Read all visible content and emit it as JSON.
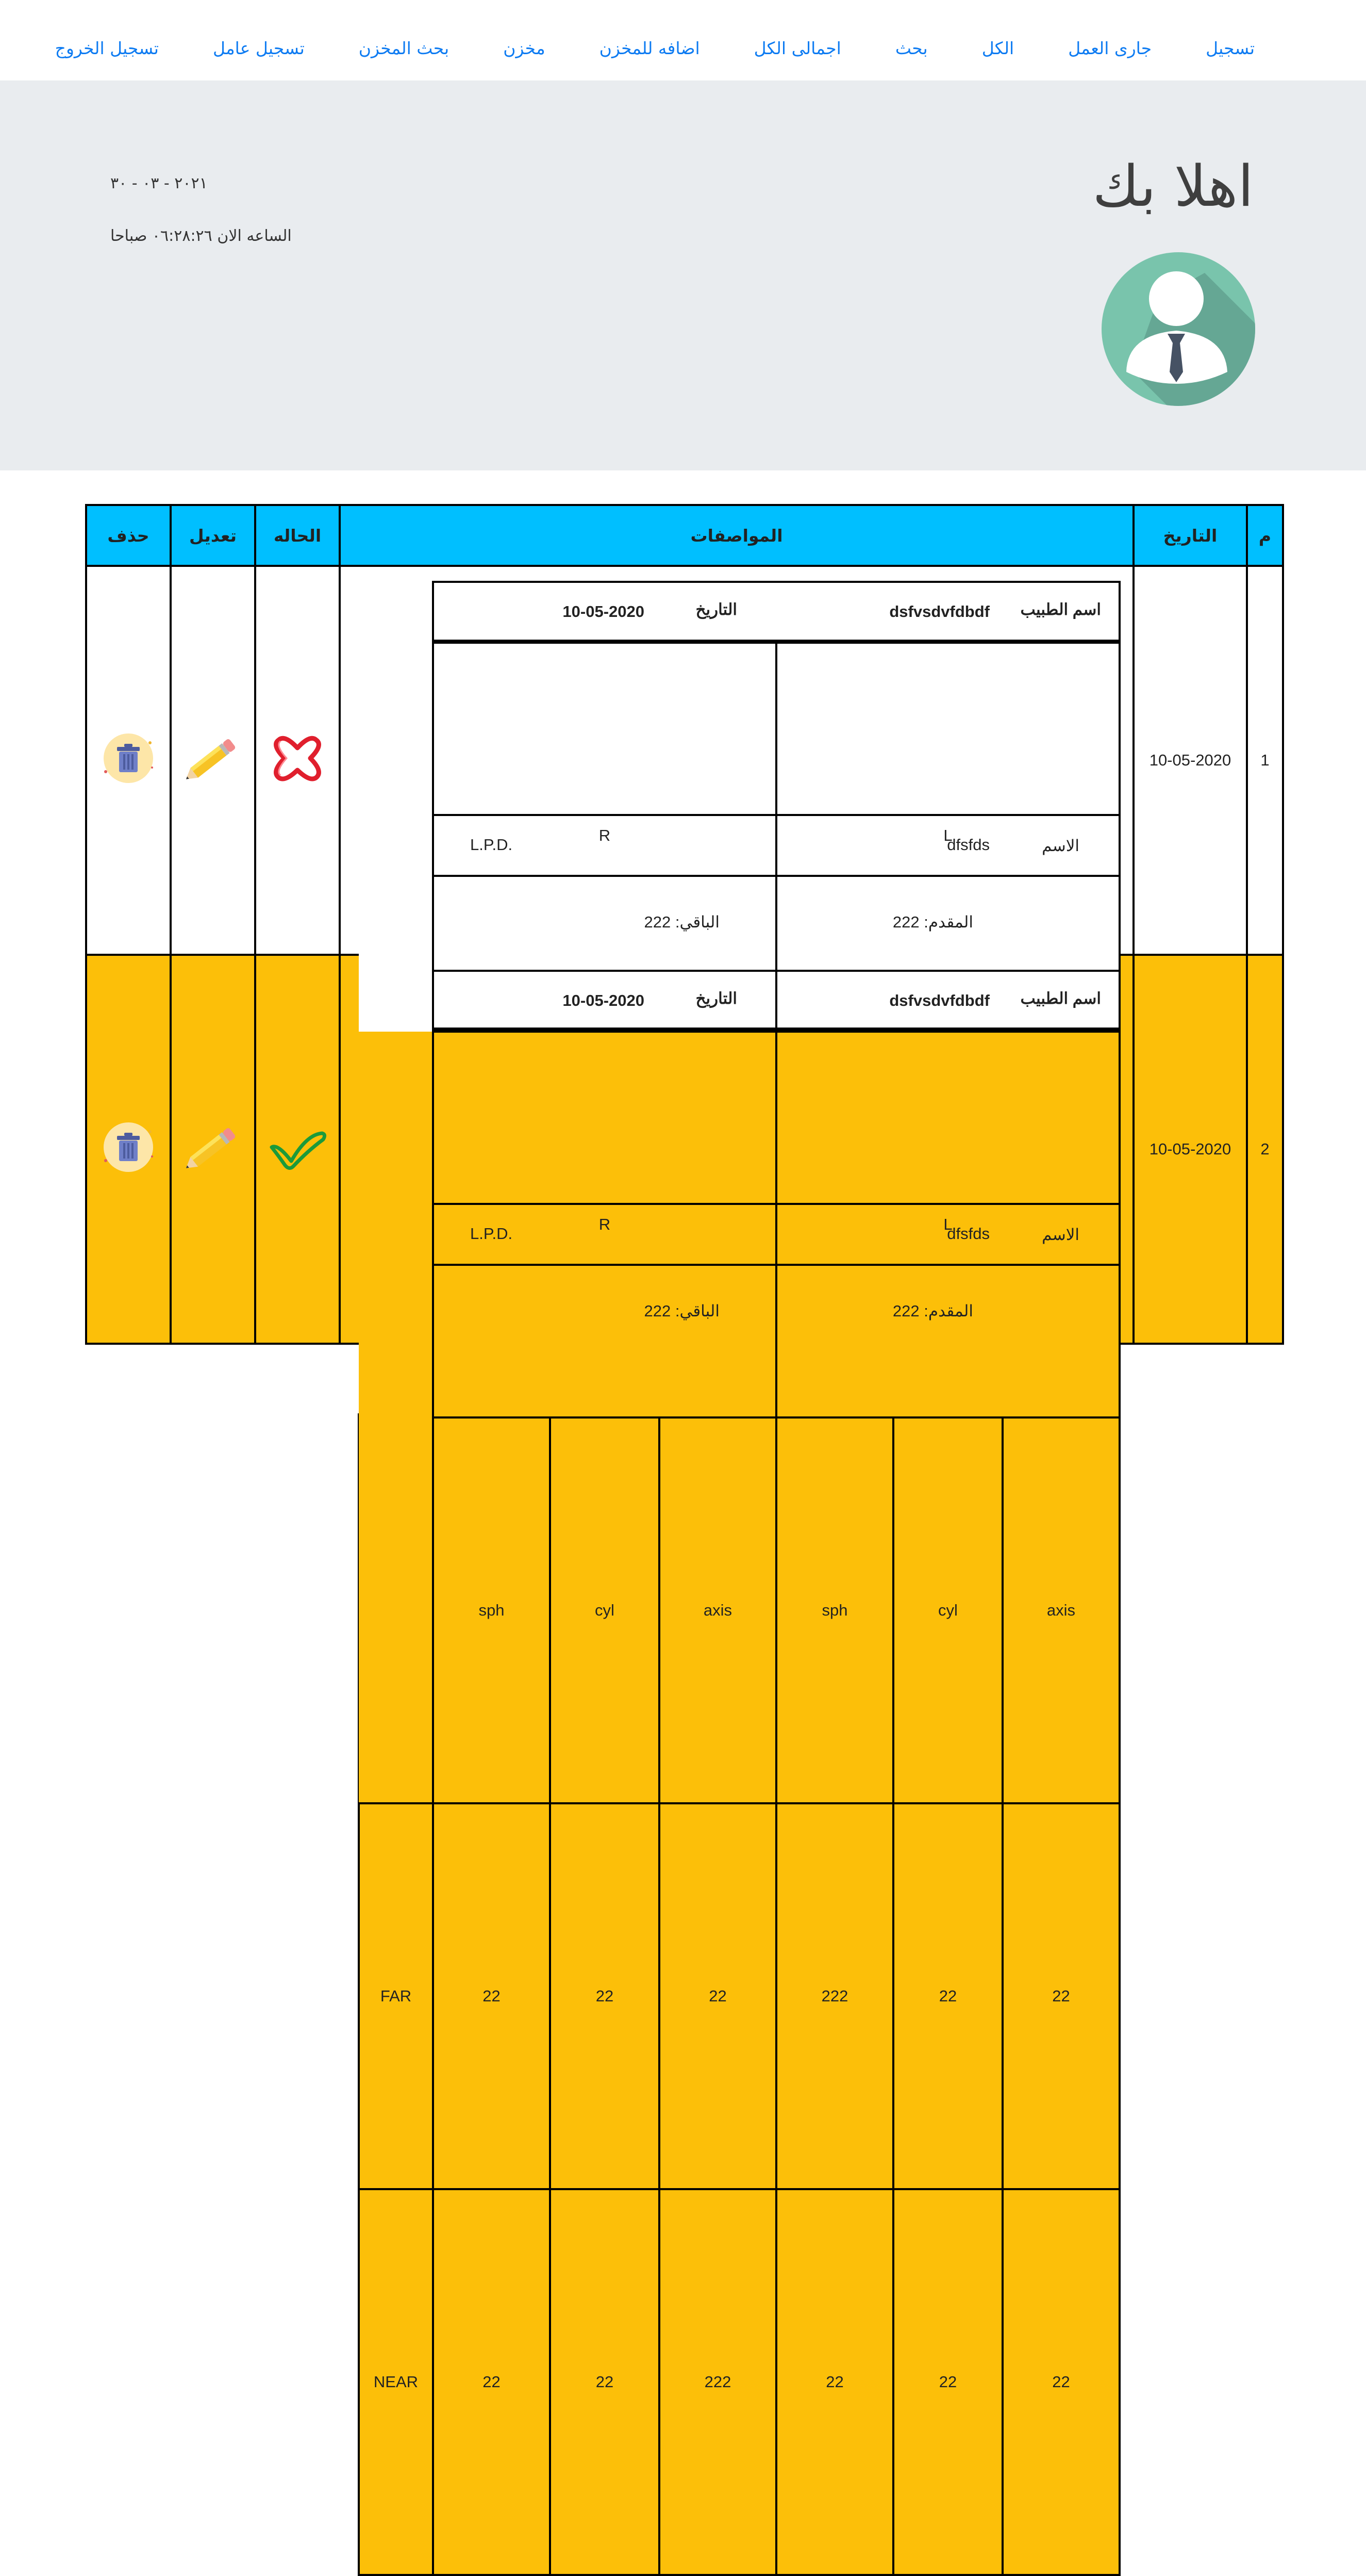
{
  "nav": {
    "items": [
      "تسجيل",
      "جارى العمل",
      "الكل",
      "بحث",
      "اجمالى الكل",
      "اضافه للمخزن",
      "مخزن",
      "بحث المخزن",
      "تسجيل عامل",
      "تسجيل الخروج"
    ]
  },
  "hero": {
    "title": "اهلا بك",
    "date": "٢٠٢١ - ٠٣ - ٣٠",
    "time": "الساعه الان ٠٦:٢٨:٢٦ صباحا",
    "avatar_icon": "user-avatar-icon",
    "avatar_color": "#79c4ac"
  },
  "table": {
    "headers": {
      "index": "م",
      "date": "التاريخ",
      "specs": "المواصفات",
      "status": "الحاله",
      "edit": "تعديل",
      "delete": "حذف"
    },
    "header_color": "#00bfff",
    "labels": {
      "doctor": "اسم الطبيب",
      "date": "التاريخ",
      "left": "L",
      "right": "R",
      "axis": "axis",
      "cyl": "cyl",
      "sph": "sph",
      "far": "FAR",
      "near": "NEAR",
      "name": "الاسم",
      "lpd": "L.P.D.",
      "advance": "المقدم: 222",
      "remaining": "الباقي: 222"
    },
    "rows": [
      {
        "index": "1",
        "date": "10-05-2020",
        "doctor_value": "dsfvsdvfdbdf",
        "spec_date": "10-05-2020",
        "far": {
          "l_axis": "22",
          "l_cyl": "22",
          "l_sph": "222",
          "r_axis": "22",
          "r_cyl": "22",
          "r_sph": "22"
        },
        "near": {
          "l_axis": "22",
          "l_cyl": "22",
          "l_sph": "22",
          "r_axis": "222",
          "r_cyl": "22",
          "r_sph": "22"
        },
        "name_value": "dfsfds",
        "status": "not-done",
        "status_icon": "red-x-icon",
        "row_color": "#ffffff"
      },
      {
        "index": "2",
        "date": "10-05-2020",
        "doctor_value": "dsfvsdvfdbdf",
        "spec_date": "10-05-2020",
        "far": {
          "l_axis": "22",
          "l_cyl": "22",
          "l_sph": "222",
          "r_axis": "22",
          "r_cyl": "22",
          "r_sph": "22"
        },
        "near": {
          "l_axis": "22",
          "l_cyl": "22",
          "l_sph": "22",
          "r_axis": "222",
          "r_cyl": "22",
          "r_sph": "22"
        },
        "name_value": "dfsfds",
        "status": "done",
        "status_icon": "green-check-icon",
        "row_color": "#fcbf09"
      }
    ],
    "edit_icon": "pencil-icon",
    "delete_icon": "trash-can-icon"
  }
}
